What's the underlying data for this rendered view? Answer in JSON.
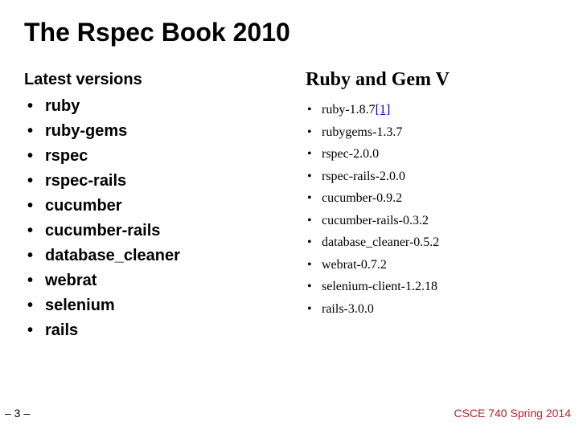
{
  "title": "The Rspec Book 2010",
  "left": {
    "heading": "Latest versions",
    "items": [
      "ruby",
      "ruby-gems",
      "rspec",
      "rspec-rails",
      "cucumber",
      "cucumber-rails",
      "database_cleaner",
      "webrat",
      "selenium",
      "rails"
    ]
  },
  "right": {
    "heading": "Ruby and Gem V",
    "items": [
      {
        "text": "ruby-1.8.7",
        "ref": "[1]"
      },
      {
        "text": "rubygems-1.3.7"
      },
      {
        "text": "rspec-2.0.0"
      },
      {
        "text": "rspec-rails-2.0.0"
      },
      {
        "text": "cucumber-0.9.2"
      },
      {
        "text": "cucumber-rails-0.3.2"
      },
      {
        "text": "database_cleaner-0.5.2"
      },
      {
        "text": "webrat-0.7.2"
      },
      {
        "text": "selenium-client-1.2.18"
      },
      {
        "text": "rails-3.0.0"
      }
    ]
  },
  "slide_number": "– 3 –",
  "footer": "CSCE 740 Spring 2014"
}
